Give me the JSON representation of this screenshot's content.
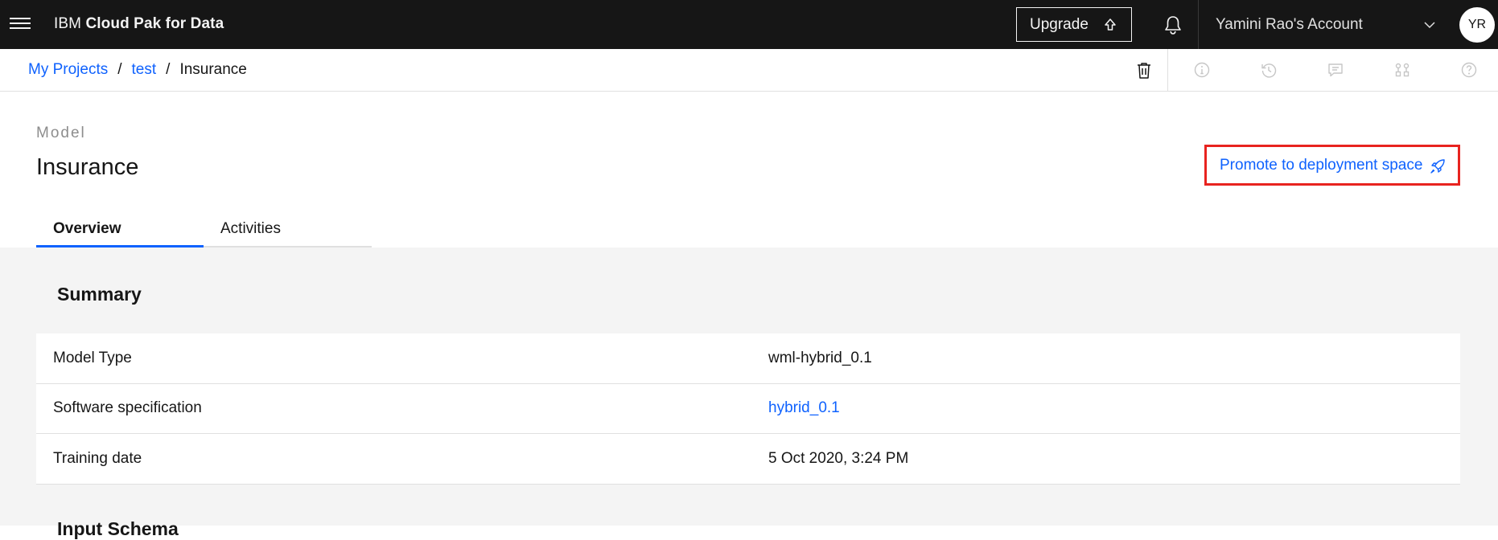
{
  "topbar": {
    "brand_prefix": "IBM",
    "brand_bold": "Cloud Pak for Data",
    "upgrade_label": "Upgrade",
    "account_label": "Yamini Rao's Account",
    "avatar_initials": "YR"
  },
  "breadcrumb": {
    "items": [
      {
        "label": "My Projects"
      },
      {
        "label": "test"
      },
      {
        "label": "Insurance"
      }
    ],
    "separator": "/"
  },
  "header": {
    "asset_type": "Model",
    "title": "Insurance",
    "promote_label": "Promote to deployment space",
    "tabs": [
      {
        "label": "Overview",
        "active": true
      },
      {
        "label": "Activities",
        "active": false
      }
    ]
  },
  "summary": {
    "title": "Summary",
    "rows": [
      {
        "key": "Model Type",
        "value": "wml-hybrid_0.1",
        "link": false
      },
      {
        "key": "Software specification",
        "value": "hybrid_0.1",
        "link": true
      },
      {
        "key": "Training date",
        "value": "5 Oct 2020, 3:24 PM",
        "link": false
      }
    ]
  },
  "next_section": {
    "title": "Input Schema"
  },
  "colors": {
    "accent": "#0f62fe",
    "topbar_bg": "#161616",
    "highlight_border": "#e8231f",
    "content_bg": "#f4f4f4"
  },
  "icons": [
    "menu-icon",
    "upload-icon",
    "notification-icon",
    "chevron-down-icon",
    "trash-icon",
    "info-icon",
    "history-icon",
    "comment-icon",
    "hierarchy-icon",
    "help-icon",
    "rocket-icon"
  ]
}
